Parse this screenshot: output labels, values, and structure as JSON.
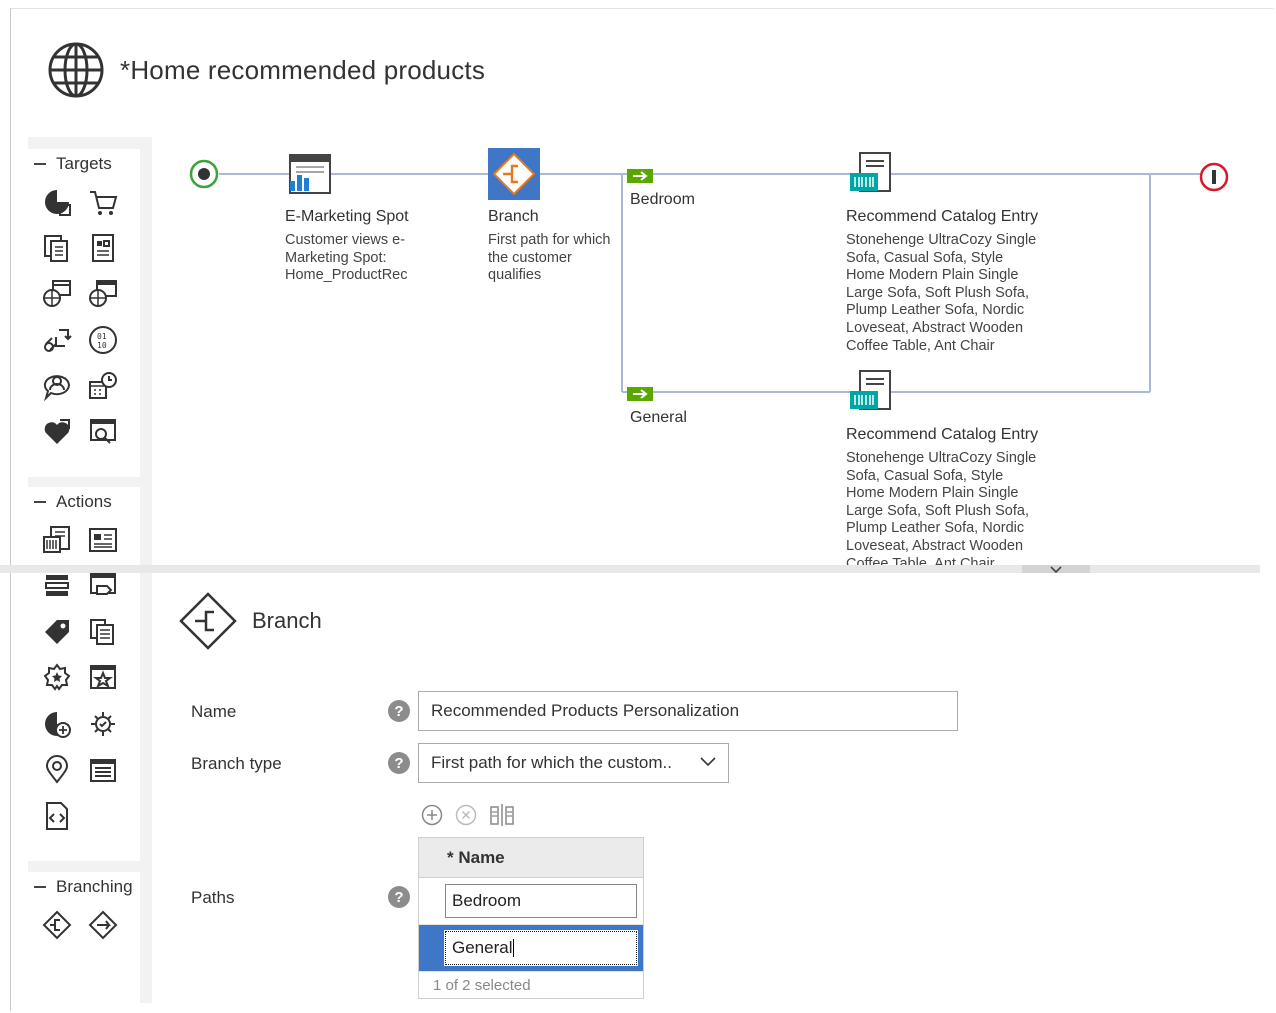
{
  "header": {
    "title": "*Home recommended products",
    "icon": "globe-icon"
  },
  "palette": {
    "targets": {
      "label": "Targets",
      "icons": [
        "pie-tag-icon",
        "cart-icon",
        "catalog-pages-icon",
        "document-grid-icon",
        "globe-calendar-icon",
        "globe-window-icon",
        "link-exchange-icon",
        "binary-circle-icon",
        "customer-chat-icon",
        "calendar-clock-icon",
        "heart-tag-icon",
        "search-window-icon"
      ]
    },
    "actions": {
      "label": "Actions",
      "icons": [
        "barcode-pages-icon",
        "content-card-icon",
        "list-bars-icon",
        "window-tag-icon",
        "tag-icon",
        "copy-pages-icon",
        "badge-gear-icon",
        "star-window-icon",
        "pie-add-icon",
        "gear-refresh-icon",
        "location-pin-icon",
        "stack-window-icon",
        "code-page-icon"
      ]
    },
    "branching": {
      "label": "Branching",
      "icons": [
        "branch-diamond-icon",
        "experiment-diamond-icon"
      ]
    }
  },
  "flow": {
    "nodes": {
      "espot": {
        "label": "E-Marketing Spot",
        "desc": [
          "Customer views e-",
          "Marketing Spot:",
          "Home_ProductRec"
        ]
      },
      "branch": {
        "label": "Branch",
        "desc": [
          "First path for which",
          "the customer",
          "qualifies"
        ]
      },
      "path1": {
        "label": "Bedroom"
      },
      "path2": {
        "label": "General"
      },
      "rec1": {
        "label": "Recommend Catalog Entry",
        "desc": [
          "Stonehenge UltraCozy Single",
          "Sofa, Casual Sofa, Style",
          "Home Modern Plain Single",
          "Large Sofa, Soft Plush Sofa,",
          "Plump Leather Sofa, Nordic",
          "Loveseat, Abstract Wooden",
          "Coffee Table, Ant Chair"
        ]
      },
      "rec2": {
        "label": "Recommend Catalog Entry",
        "desc": [
          "Stonehenge UltraCozy Single",
          "Sofa, Casual Sofa, Style",
          "Home Modern Plain Single",
          "Large Sofa, Soft Plush Sofa,",
          "Plump Leather Sofa, Nordic",
          "Loveseat, Abstract Wooden",
          "Coffee Table, Ant Chair"
        ]
      }
    }
  },
  "properties": {
    "title": "Branch",
    "name_label": "Name",
    "name_value": "Recommended Products Personalization",
    "branch_type_label": "Branch type",
    "branch_type_value": "First path for which the custom..",
    "paths_label": "Paths",
    "help_glyph": "?",
    "grid": {
      "header": "* Name",
      "rows": [
        "Bedroom",
        "General"
      ],
      "selected_index": 1,
      "footer": "1 of 2 selected"
    }
  },
  "colors": {
    "accent": "#3f76c6",
    "start": "#3aa33a",
    "end": "#d9182d",
    "path_tag": "#5aa700",
    "branch_orange": "#e8781e"
  }
}
